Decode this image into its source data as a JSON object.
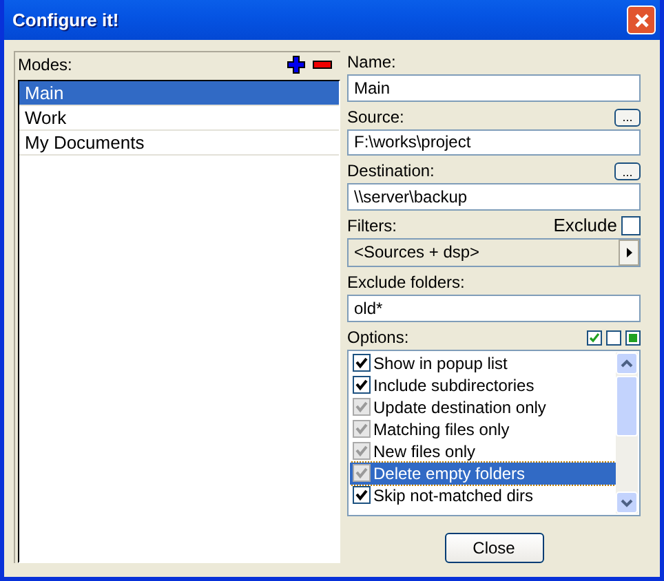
{
  "window": {
    "title": "Configure it!"
  },
  "modes": {
    "label": "Modes:",
    "items": [
      {
        "label": "Main",
        "selected": true
      },
      {
        "label": "Work",
        "selected": false
      },
      {
        "label": "My Documents",
        "selected": false
      }
    ]
  },
  "name": {
    "label": "Name:",
    "value": "Main"
  },
  "source": {
    "label": "Source:",
    "value": "F:\\works\\project",
    "browse": "..."
  },
  "destination": {
    "label": "Destination:",
    "value": "\\\\server\\backup",
    "browse": "..."
  },
  "filters": {
    "label": "Filters:",
    "value": "<Sources + dsp>",
    "exclude_label": "Exclude",
    "exclude_checked": false
  },
  "exclude_folders": {
    "label": "Exclude folders:",
    "value": "old*"
  },
  "options": {
    "label": "Options:",
    "items": [
      {
        "label": "Show in popup list",
        "checked": true,
        "disabled": false,
        "selected": false
      },
      {
        "label": "Include subdirectories",
        "checked": true,
        "disabled": false,
        "selected": false
      },
      {
        "label": "Update destination only",
        "checked": true,
        "disabled": true,
        "selected": false
      },
      {
        "label": "Matching files only",
        "checked": true,
        "disabled": true,
        "selected": false
      },
      {
        "label": "New files only",
        "checked": true,
        "disabled": true,
        "selected": false
      },
      {
        "label": "Delete empty folders",
        "checked": true,
        "disabled": true,
        "selected": true
      },
      {
        "label": "Skip not-matched dirs",
        "checked": true,
        "disabled": false,
        "selected": false
      }
    ]
  },
  "buttons": [
    "Close"
  ]
}
